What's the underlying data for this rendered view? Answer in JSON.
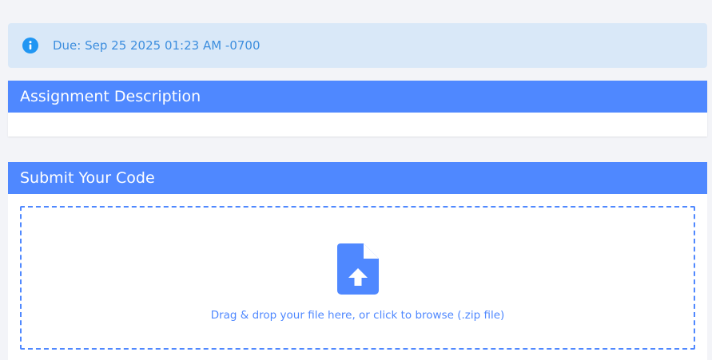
{
  "due_banner": {
    "icon": "info-icon",
    "text": "Due: Sep 25 2025 01:23 AM -0700"
  },
  "description_section": {
    "title": "Assignment Description"
  },
  "submit_section": {
    "title": "Submit Your Code",
    "dropzone": {
      "icon": "file-upload-icon",
      "text": "Drag & drop your file here, or click to browse (.zip file)"
    }
  },
  "colors": {
    "accent": "#4f88ff",
    "banner_bg": "#d9e8f8",
    "banner_text": "#3d8ede",
    "page_bg": "#f3f4f8"
  }
}
